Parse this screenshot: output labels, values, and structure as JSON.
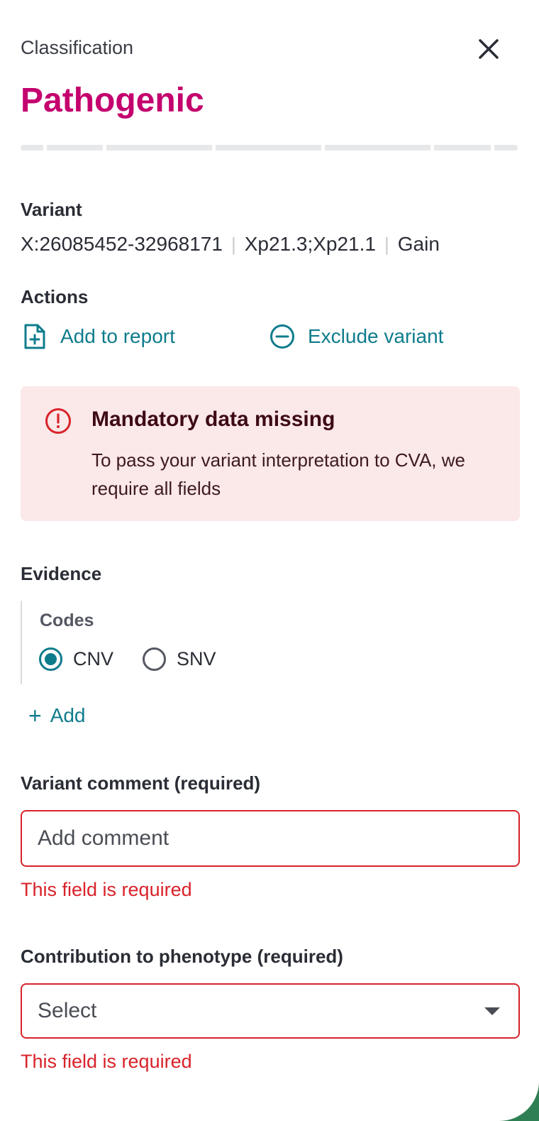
{
  "header": {
    "label": "Classification",
    "title": "Pathogenic"
  },
  "variant": {
    "heading": "Variant",
    "coordinates": "X:26085452-32968171",
    "cytoband": "Xp21.3;Xp21.1",
    "type": "Gain"
  },
  "actions": {
    "heading": "Actions",
    "add_to_report": "Add to report",
    "exclude_variant": "Exclude variant"
  },
  "alert": {
    "title": "Mandatory data missing",
    "message": "To pass your variant interpretation to CVA, we require all fields"
  },
  "evidence": {
    "heading": "Evidence",
    "codes_label": "Codes",
    "options": [
      {
        "label": "CNV",
        "selected": true
      },
      {
        "label": "SNV",
        "selected": false
      }
    ],
    "add_label": "Add"
  },
  "variant_comment": {
    "label": "Variant comment (required)",
    "placeholder": "Add comment",
    "value": "",
    "error": "This field is required"
  },
  "contribution": {
    "label": "Contribution to phenotype (required)",
    "selected": "Select",
    "error": "This field is required"
  },
  "colors": {
    "title": "#c4006e",
    "link": "#0f7c8c",
    "error": "#d8232a",
    "alert_bg": "#fbe8e8"
  }
}
